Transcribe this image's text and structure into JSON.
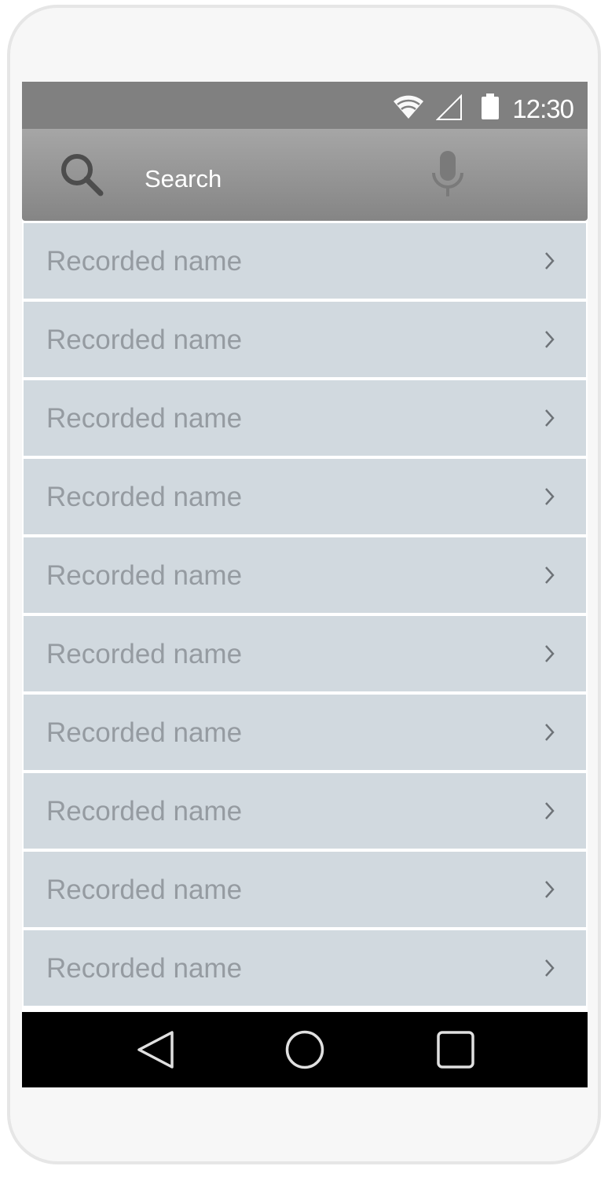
{
  "status_bar": {
    "time": "12:30",
    "icons": [
      "wifi-icon",
      "cell-signal-icon",
      "battery-icon"
    ]
  },
  "search": {
    "label": "Search",
    "icons": [
      "search-icon",
      "mic-icon"
    ]
  },
  "list": {
    "items": [
      {
        "label": "Recorded name"
      },
      {
        "label": "Recorded name"
      },
      {
        "label": "Recorded name"
      },
      {
        "label": "Recorded name"
      },
      {
        "label": "Recorded name"
      },
      {
        "label": "Recorded name"
      },
      {
        "label": "Recorded name"
      },
      {
        "label": "Recorded name"
      },
      {
        "label": "Recorded name"
      },
      {
        "label": "Recorded name"
      }
    ]
  },
  "nav_bar": {
    "buttons": [
      "back-icon",
      "home-icon",
      "recents-icon"
    ]
  },
  "colors": {
    "status_bar": "#808080",
    "search_bar_top": "#a6a6a6",
    "search_bar_bottom": "#858585",
    "list_item_bg": "#d1d9df",
    "list_item_text": "#959ba1",
    "nav_bar": "#000000"
  }
}
